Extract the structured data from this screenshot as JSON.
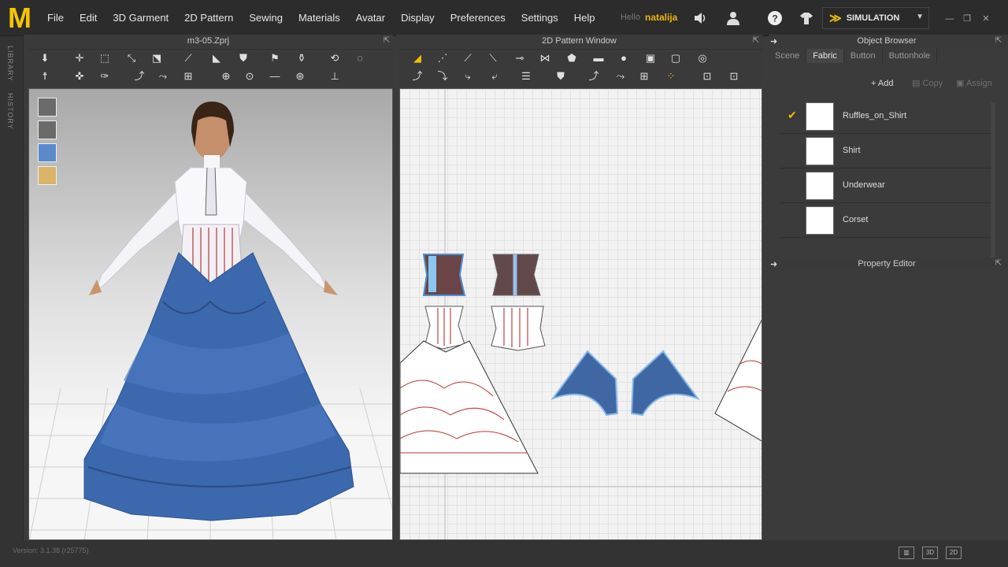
{
  "app": {
    "logo": "M"
  },
  "menu": [
    "File",
    "Edit",
    "3D Garment",
    "2D Pattern",
    "Sewing",
    "Materials",
    "Avatar",
    "Display",
    "Preferences",
    "Settings",
    "Help"
  ],
  "user": {
    "hello": "Hello",
    "name": "natalija"
  },
  "simulation": {
    "label": "SIMULATION"
  },
  "side_tabs": {
    "library": "LIBRARY",
    "history": "HISTORY"
  },
  "view3d": {
    "title": "m3-05.Zprj"
  },
  "view2d": {
    "title": "2D Pattern Window"
  },
  "object_browser": {
    "title": "Object Browser",
    "tabs": [
      "Scene",
      "Fabric",
      "Button",
      "Buttonhole"
    ],
    "active_tab": "Fabric",
    "actions": {
      "add": "Add",
      "copy": "Copy",
      "assign": "Assign"
    },
    "items": [
      {
        "name": "Ruffles_on_Shirt",
        "checked": true
      },
      {
        "name": "Shirt",
        "checked": false
      },
      {
        "name": "Underwear",
        "checked": false
      },
      {
        "name": "Corset",
        "checked": false
      }
    ]
  },
  "property_editor": {
    "title": "Property Editor"
  },
  "status": {
    "version": "Version: 3.1.38 (r25775)"
  },
  "view_modes": [
    "3D",
    "2D"
  ],
  "colors": {
    "accent": "#f5c400",
    "dress": "#3c68ad",
    "pattern_fill": "#3f67a4"
  }
}
